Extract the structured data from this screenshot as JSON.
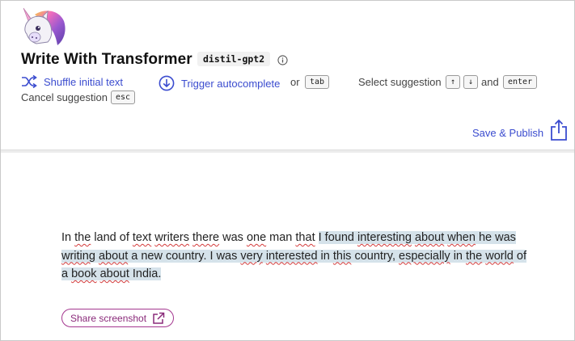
{
  "header": {
    "title": "Write With Transformer",
    "model": "distil-gpt2",
    "logo_icon": "unicorn-icon",
    "info_icon": "info-icon"
  },
  "toolbar": {
    "shuffle_label": "Shuffle initial text",
    "shuffle_icon": "shuffle-icon",
    "autocomplete_label": "Trigger autocomplete",
    "autocomplete_icon": "download-circle-icon",
    "or_text": "or",
    "tab_key": "tab",
    "select_label": "Select suggestion",
    "up_key": "↑",
    "down_key": "↓",
    "and_text": "and",
    "enter_key": "enter",
    "cancel_label": "Cancel suggestion",
    "esc_key": "esc",
    "save_label": "Save & Publish",
    "save_icon": "share-upload-icon"
  },
  "editor": {
    "prefix_words": [
      "In",
      " ",
      "the",
      " land of ",
      "text",
      " ",
      "writers",
      " ",
      "there",
      " was ",
      "one",
      " man ",
      "that"
    ],
    "text_plain": "In the land of text writers there was one man that",
    "suggestion_text": "I found interesting about when he was writing about a new country. I was very interested in this country, especially in the world of a book about India."
  },
  "share": {
    "label": "Share screenshot",
    "icon": "external-link-icon"
  },
  "colors": {
    "accent": "#3b4ccf",
    "share_border": "#a4378f",
    "highlight": "#d5e2ea",
    "spell_underline": "#d43a3a"
  }
}
